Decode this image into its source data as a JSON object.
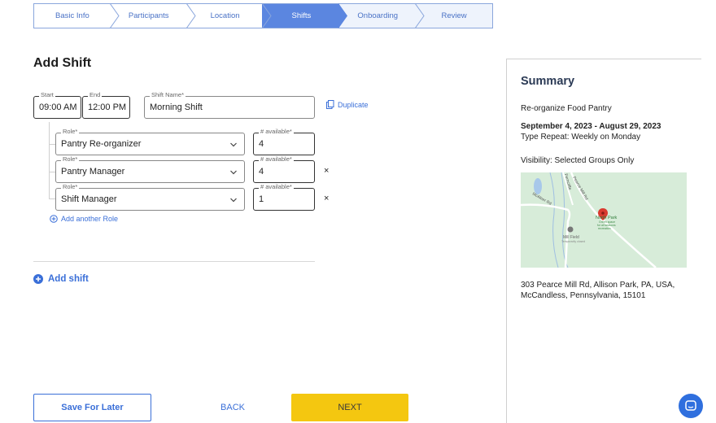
{
  "stepper": {
    "steps": [
      {
        "label": "Basic Info",
        "state": "done"
      },
      {
        "label": "Participants",
        "state": "done"
      },
      {
        "label": "Location",
        "state": "done"
      },
      {
        "label": "Shifts",
        "state": "active"
      },
      {
        "label": "Onboarding",
        "state": "future"
      },
      {
        "label": "Review",
        "state": "future"
      }
    ]
  },
  "page_title": "Add Shift",
  "shift": {
    "start_label": "Start",
    "start_value": "09:00 AM",
    "end_label": "End",
    "end_value": "12:00 PM",
    "name_label": "Shift Name*",
    "name_value": "Morning Shift",
    "duplicate_label": "Duplicate"
  },
  "roles": [
    {
      "role_label": "Role*",
      "role_value": "Pantry Re-organizer",
      "avail_label": "# available*",
      "avail_value": "4",
      "removable": false
    },
    {
      "role_label": "Role*",
      "role_value": "Pantry Manager",
      "avail_label": "# available*",
      "avail_value": "4",
      "removable": true
    },
    {
      "role_label": "Role*",
      "role_value": "Shift Manager",
      "avail_label": "# available*",
      "avail_value": "1",
      "removable": true
    }
  ],
  "remove_glyph": "×",
  "add_role_label": "Add another Role",
  "add_shift_label": "Add shift",
  "buttons": {
    "save_later": "Save For Later",
    "back": "BACK",
    "next": "NEXT"
  },
  "summary": {
    "title": "Summary",
    "event_name": "Re-organize Food Pantry",
    "date_range": "September 4, 2023 - August 29, 2023",
    "repeat": "Type Repeat: Weekly on Monday",
    "visibility": "Visibility: Selected Groups Only",
    "address_line1": "303 Pearce Mill Rd, Allison Park, PA, USA,",
    "address_line2": "McCandless, Pennsylvania, 15101",
    "map": {
      "road_labels": [
        "McAleer Rd",
        "Pearce Mill Rd",
        "Ferncliffe"
      ],
      "poi_labels": [
        "North Park",
        "Mill Field"
      ],
      "poi_sub": [
        "Green space",
        "for all seasons",
        "recreation"
      ],
      "poi_sub2": "Temporarily closed"
    }
  },
  "colors": {
    "accent": "#3a6fd8",
    "step_active": "#5b86e0",
    "next_button": "#f4c710",
    "map_bg": "#d7ecd9",
    "map_pin": "#d93a2f"
  },
  "icons": {
    "duplicate": "copy-icon",
    "add_role": "plus-circle-icon",
    "add_shift": "plus-circle-filled-icon",
    "dropdown": "chevron-down-icon",
    "chat": "chat-icon",
    "pin": "map-pin-icon"
  }
}
